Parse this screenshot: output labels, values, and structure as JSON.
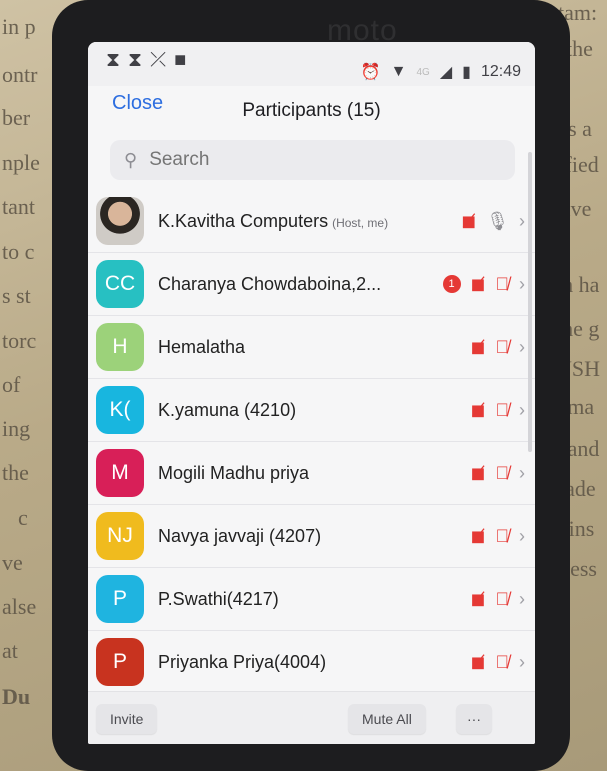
{
  "background_text": [
    "in p",
    "ontr",
    "ber",
    "nple",
    "tant",
    "to c",
    "s st",
    "torc",
    "of",
    "ing",
    "the",
    "c",
    "ve",
    "alse",
    "at",
    "Du",
    "tam:",
    "the",
    "is a",
    "sfied",
    "sive",
    "th ha",
    "the g",
    "USH",
    "e ma",
    "l and",
    "made",
    "re ins",
    "rocess"
  ],
  "phone_brand": "moto",
  "status": {
    "network": "4G",
    "time": "12:49"
  },
  "header": {
    "close_label": "Close",
    "title": "Participants (15)"
  },
  "search": {
    "placeholder": "Search"
  },
  "participants": [
    {
      "initials": "",
      "name": "K.Kavitha Computers",
      "role": "(Host, me)",
      "avatar_color": "",
      "photo": true,
      "badge": "",
      "mic": "on"
    },
    {
      "initials": "CC",
      "name": "Charanya Chowdaboina,2...",
      "role": "",
      "avatar_color": "#27c0c2",
      "badge": "1",
      "mic": "off"
    },
    {
      "initials": "H",
      "name": "Hemalatha",
      "role": "",
      "avatar_color": "#9cd27a",
      "badge": "",
      "mic": "off"
    },
    {
      "initials": "K(",
      "name": "K.yamuna (4210)",
      "role": "",
      "avatar_color": "#18b6df",
      "badge": "",
      "mic": "off"
    },
    {
      "initials": "M",
      "name": "Mogili Madhu priya",
      "role": "",
      "avatar_color": "#d81f58",
      "badge": "",
      "mic": "off"
    },
    {
      "initials": "NJ",
      "name": "Navya javvaji (4207)",
      "role": "",
      "avatar_color": "#f0bb1e",
      "badge": "",
      "mic": "off"
    },
    {
      "initials": "P",
      "name": "P.Swathi(4217)",
      "role": "",
      "avatar_color": "#1fb4e0",
      "badge": "",
      "mic": "off"
    },
    {
      "initials": "P",
      "name": "Priyanka Priya(4004)",
      "role": "",
      "avatar_color": "#c8331f",
      "badge": "",
      "mic": "off"
    }
  ],
  "footer": {
    "invite_label": "Invite",
    "mute_all_label": "Mute All",
    "more_label": "···"
  },
  "icons": {
    "camera_off": "video-off-icon",
    "mic_off": "mic-off-icon",
    "mic_on": "mic-icon",
    "chevron": "chevron-right-icon"
  }
}
